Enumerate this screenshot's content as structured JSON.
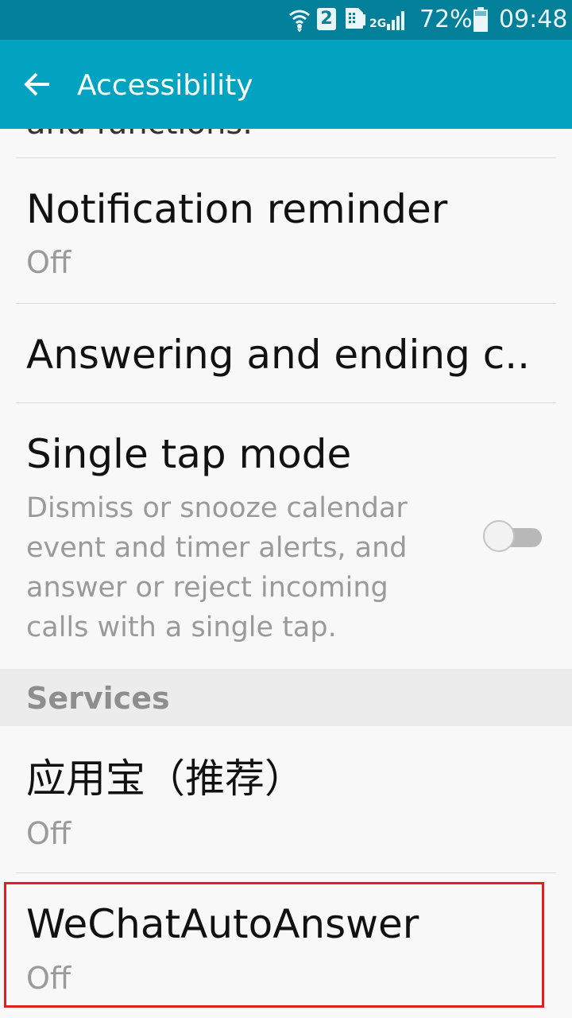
{
  "status_bar": {
    "icons": [
      "wifi-icon",
      "sim-2-icon",
      "sim-card-icon",
      "signal-2g-icon",
      "battery-icon"
    ],
    "network": "2G",
    "sim_label": "2",
    "battery_percent": "72%",
    "time": "09:48"
  },
  "app_bar": {
    "back_icon": "arrow-left-icon",
    "title": "Accessibility"
  },
  "list": {
    "partial_item_text": "and functions.",
    "items": [
      {
        "title": "Notification reminder",
        "subtitle": "Off"
      },
      {
        "title": "Answering and ending c.."
      },
      {
        "title": "Single tap mode",
        "description": "Dismiss or snooze calendar event and timer alerts, and answer or reject incoming calls with a single tap.",
        "toggle_state": "off"
      }
    ],
    "section_header": "Services",
    "services": [
      {
        "title": "应用宝（推荐）",
        "subtitle": "Off"
      },
      {
        "title": "WeChatAutoAnswer",
        "subtitle": "Off",
        "highlighted": true
      }
    ]
  },
  "colors": {
    "status_bar": "#02809a",
    "app_bar": "#02a3c0",
    "highlight": "#e02020"
  }
}
